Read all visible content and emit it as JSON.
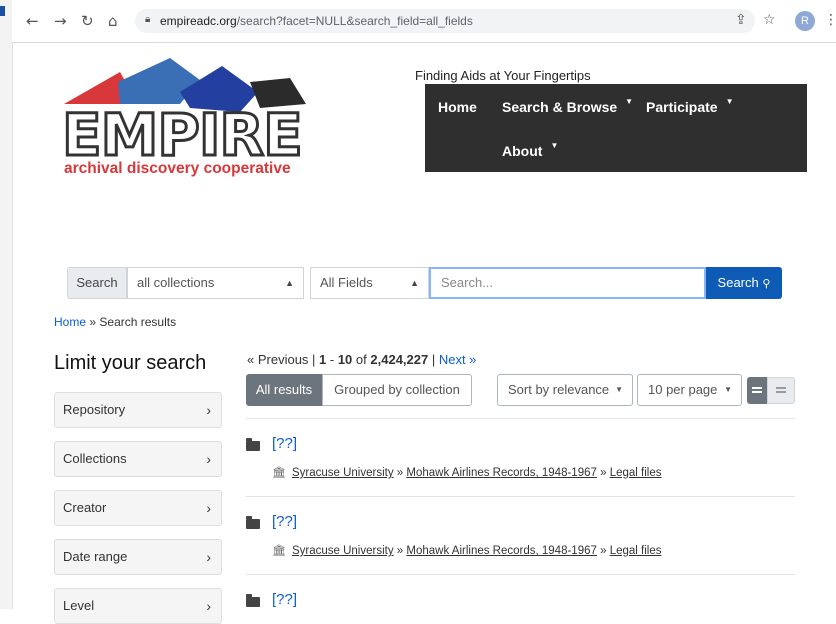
{
  "browser": {
    "url_domain": "empireadc.org",
    "url_path": "/search?facet=NULL&search_field=all_fields",
    "profile_initial": "R",
    "icons": [
      "back-icon",
      "forward-icon",
      "reload-icon",
      "home-icon",
      "lock-icon",
      "share-icon",
      "star-icon",
      "avatar",
      "more-icon"
    ]
  },
  "logo": {
    "wordmark": "EMPIRE",
    "subtitle": "archival discovery cooperative"
  },
  "header": {
    "tagline": "Finding Aids at Your Fingertips",
    "nav": [
      "Home",
      "Search & Browse",
      "Participate",
      "About"
    ]
  },
  "search": {
    "label": "Search",
    "collection_select": "all collections",
    "field_select": "All Fields",
    "placeholder": "Search...",
    "button": "Search"
  },
  "breadcrumb": {
    "home": "Home",
    "separator": "»",
    "current": "Search results"
  },
  "sidebar": {
    "title": "Limit your search",
    "facets": [
      "Repository",
      "Collections",
      "Creator",
      "Date range",
      "Level"
    ]
  },
  "pager": {
    "previous": "« Previous",
    "start": "1",
    "end": "10",
    "of": "of",
    "total": "2,424,227",
    "next": "Next »"
  },
  "toolbar": {
    "all_results": "All results",
    "grouped": "Grouped by collection",
    "sort": "Sort by relevance",
    "per_page": "10 per page"
  },
  "results": [
    {
      "title": "[??]",
      "repository": "Syracuse University",
      "collection": "Mohawk Airlines Records, 1948-1967",
      "series": "Legal files"
    },
    {
      "title": "[??]",
      "repository": "Syracuse University",
      "collection": "Mohawk Airlines Records, 1948-1967",
      "series": "Legal files"
    },
    {
      "title": "[??]"
    }
  ],
  "colors": {
    "nav_bg": "#2f2f2f",
    "link": "#0b5ed7",
    "search_button": "#0d5bb5",
    "active_toggle": "#6c757d",
    "logo_red": "#d9383a"
  }
}
